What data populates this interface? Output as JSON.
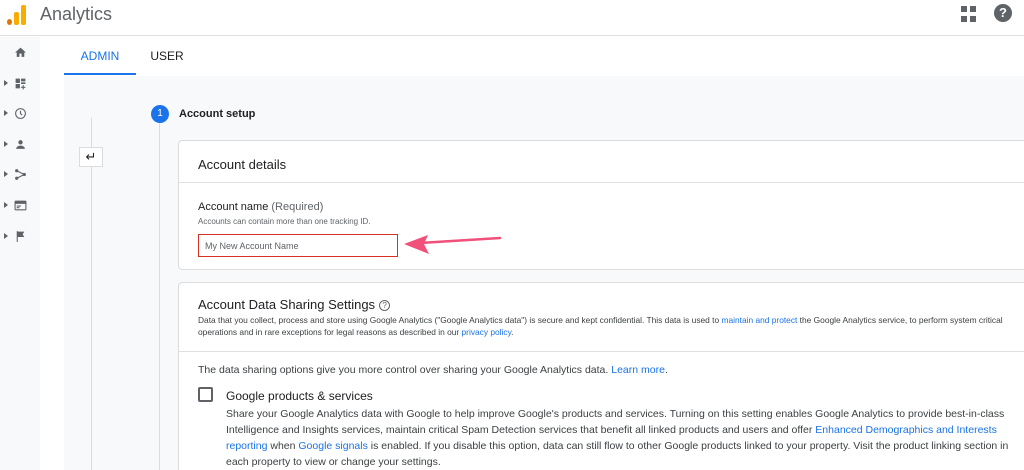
{
  "header": {
    "app_title": "Analytics"
  },
  "rail": {
    "items": [
      "home-icon",
      "customization-icon",
      "realtime-icon",
      "audience-icon",
      "acquisition-icon",
      "behavior-icon",
      "conversions-icon"
    ]
  },
  "tabs": [
    {
      "label": "ADMIN",
      "active": true
    },
    {
      "label": "USER",
      "active": false
    }
  ],
  "step": {
    "number": "1",
    "title": "Account setup"
  },
  "account_details": {
    "title": "Account details",
    "field_label": "Account name",
    "required": "(Required)",
    "hint": "Accounts can contain more than one tracking ID.",
    "placeholder": "My New Account Name"
  },
  "sharing": {
    "title": "Account Data Sharing Settings",
    "desc_1": "Data that you collect, process and store using Google Analytics (\"Google Analytics data\") is secure and kept confidential. This data is used to ",
    "desc_link_1": "maintain and protect",
    "desc_2": " the Google Analytics service, to perform system critical operations and in rare exceptions for legal reasons as described in our ",
    "desc_link_2": "privacy policy",
    "desc_3": ".",
    "options_intro": "The data sharing options give you more control over sharing your Google Analytics data. ",
    "learn_more": "Learn more",
    "learn_more_end": ".",
    "option": {
      "title": "Google products & services",
      "desc_1": "Share your Google Analytics data with Google to help improve Google's products and services. Turning on this setting enables Google Analytics to provide best-in-class Intelligence and Insights services, maintain critical Spam Detection services that benefit all linked products and users and offer ",
      "link_1": "Enhanced Demographics and Interests reporting",
      "desc_2": " when ",
      "link_2": "Google signals",
      "desc_3": " is enabled. If you disable this option, data can still flow to other Google products linked to your property. Visit the product linking section in each property to view or change your settings."
    }
  },
  "colors": {
    "accent": "#1a73e8",
    "error": "#d93025",
    "annotation_arrow": "#f0507a"
  }
}
